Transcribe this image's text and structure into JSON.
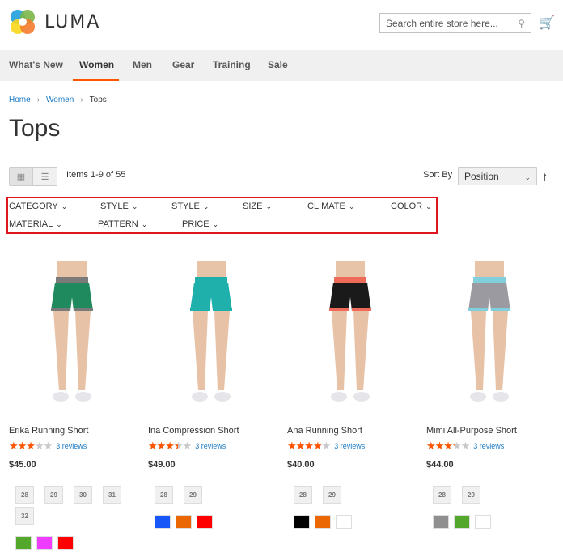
{
  "header": {
    "logo_text": "LUMA",
    "search_placeholder": "Search entire store here..."
  },
  "nav": [
    {
      "label": "What's New"
    },
    {
      "label": "Women",
      "active": true
    },
    {
      "label": "Men"
    },
    {
      "label": "Gear"
    },
    {
      "label": "Training"
    },
    {
      "label": "Sale"
    }
  ],
  "breadcrumb": [
    "Home",
    "Women",
    "Tops"
  ],
  "page_title": "Tops",
  "toolbar": {
    "items_text": "Items 1-9 of 55",
    "sort_label": "Sort By",
    "sort_value": "Position"
  },
  "filters": [
    "CATEGORY",
    "STYLE",
    "STYLE",
    "SIZE",
    "CLIMATE",
    "COLOR",
    "MATERIAL",
    "PATTERN",
    "PRICE"
  ],
  "accent": "#ff5501",
  "products": [
    {
      "name": "Erika Running Short",
      "rating_pct": 60,
      "reviews": "3 reviews",
      "price": "$45.00",
      "sizes": [
        "28",
        "29",
        "30",
        "31",
        "32"
      ],
      "colors": [
        "#53a72a",
        "#ef3dff",
        "#ff0000"
      ],
      "shorts": "#1f8a5e",
      "trim": "#7a7a7a"
    },
    {
      "name": "Ina Compression Short",
      "rating_pct": 70,
      "reviews": "3 reviews",
      "price": "$49.00",
      "sizes": [
        "28",
        "29"
      ],
      "colors": [
        "#1857f7",
        "#eb6703",
        "#ff0000"
      ],
      "shorts": "#1fb0ac",
      "trim": "#1fb0ac"
    },
    {
      "name": "Ana Running Short",
      "rating_pct": 80,
      "reviews": "3 reviews",
      "price": "$40.00",
      "sizes": [
        "28",
        "29"
      ],
      "colors": [
        "#000000",
        "#eb6703",
        "#ffffff"
      ],
      "shorts": "#1a1a1a",
      "trim": "#f06a5a"
    },
    {
      "name": "Mimi All-Purpose Short",
      "rating_pct": 67,
      "reviews": "3 reviews",
      "price": "$44.00",
      "sizes": [
        "28",
        "29"
      ],
      "colors": [
        "#8f8f8f",
        "#53a72a",
        "#ffffff"
      ],
      "shorts": "#9a9aa0",
      "trim": "#7fd0dc"
    }
  ]
}
